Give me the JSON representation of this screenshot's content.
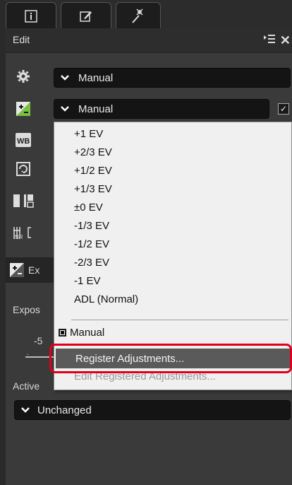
{
  "edit_panel": {
    "title": "Edit"
  },
  "rows": {
    "picture_control_value": "Manual",
    "exposure_value": "Manual"
  },
  "sub_panel": {
    "header_label": "Ex",
    "exposure_label": "Expos",
    "slider_min_label": "-5",
    "active_label": "Active",
    "unchanged_value": "Unchanged"
  },
  "menu": {
    "items": [
      "+1 EV",
      "+2/3 EV",
      "+1/2 EV",
      "+1/3 EV",
      "±0 EV",
      "-1/3 EV",
      "-1/2 EV",
      "-2/3 EV",
      "-1 EV",
      "ADL (Normal)"
    ],
    "manual_label": "Manual",
    "register_label": "Register Adjustments...",
    "edit_registered_label": "Edit Registered Adjustments..."
  },
  "colors": {
    "highlight": "#e0001a",
    "menu_bg": "#f0f0f0",
    "panel_bg": "#3a3a3a"
  }
}
